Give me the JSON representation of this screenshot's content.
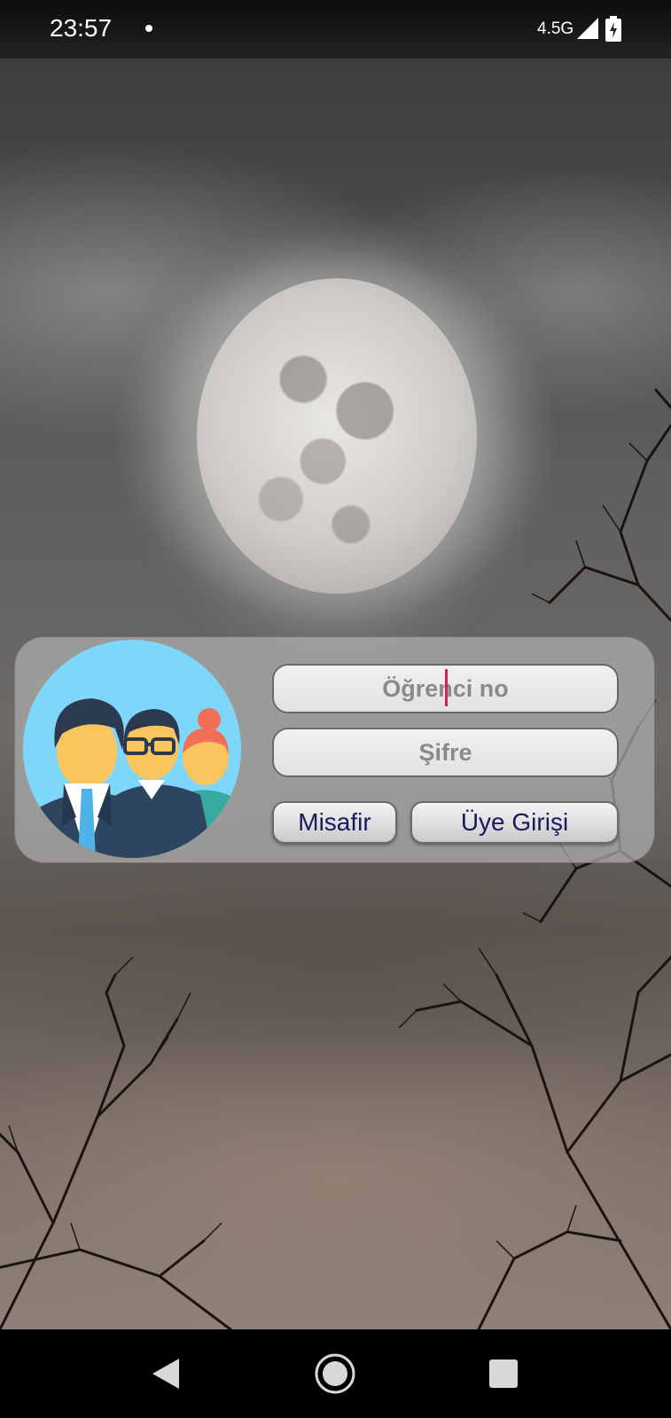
{
  "status_bar": {
    "time": "23:57",
    "network": "4.5G",
    "icons": [
      "notification-dot-icon",
      "signal-icon",
      "battery-charging-icon"
    ]
  },
  "login": {
    "student_no_placeholder": "Öğrenci no",
    "password_placeholder": "Şifre",
    "guest_button": "Misafir",
    "member_login_button": "Üye Girişi",
    "avatar_icon": "user-group-icon"
  },
  "nav_bar": {
    "icons": [
      "back-icon",
      "home-icon",
      "recent-apps-icon"
    ]
  },
  "colors": {
    "button_text": "#1a1a5a",
    "placeholder_text": "#8a8a8a",
    "cursor": "#d81b60",
    "avatar_background": "#7fd6fb"
  }
}
